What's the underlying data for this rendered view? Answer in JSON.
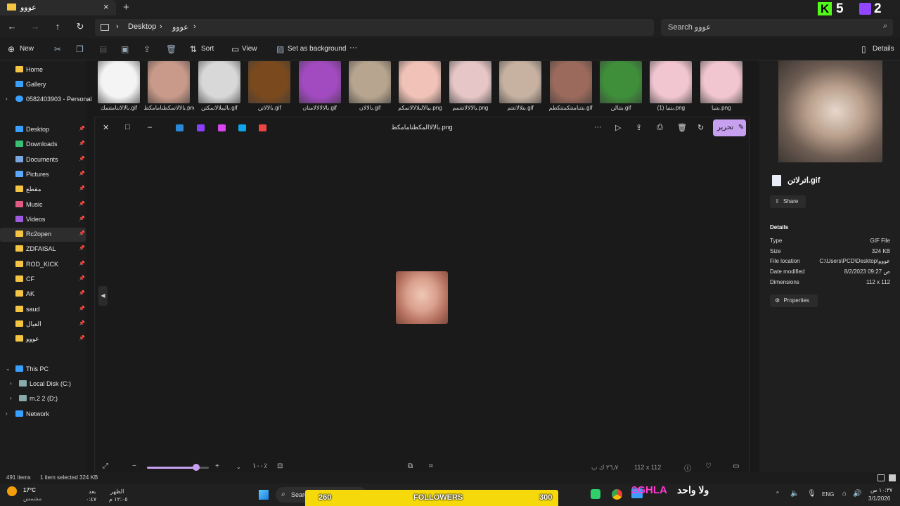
{
  "window": {
    "tab_title": "عووو",
    "tab_close": "×",
    "new_tab": "+",
    "kick_letter": "K",
    "kick_count": "5",
    "twitch_count": "2"
  },
  "address": {
    "back": "←",
    "forward": "→",
    "up": "↑",
    "refresh": "↻",
    "crumbs": [
      "Desktop",
      "عووو"
    ],
    "crumb_sep": "›",
    "search_placeholder": "Search عووو",
    "search_icon": "⌕"
  },
  "toolbar": {
    "new_label": "New",
    "sort_label": "Sort",
    "view_label": "View",
    "set_bg_label": "Set as background",
    "more_label": "···",
    "details_label": "Details"
  },
  "sidebar": {
    "top": [
      {
        "label": "Home",
        "color": "#f4c542"
      },
      {
        "label": "Gallery",
        "color": "#3aa0ff"
      },
      {
        "label": "0582403903 - Personal",
        "color": "#3aa0ff"
      }
    ],
    "pinned": [
      {
        "label": "Desktop",
        "color": "#3aa0ff"
      },
      {
        "label": "Downloads",
        "color": "#38c172"
      },
      {
        "label": "Documents",
        "color": "#7aa7e0"
      },
      {
        "label": "Pictures",
        "color": "#5aa8ff"
      },
      {
        "label": "مقطع",
        "color": "#f4c542"
      },
      {
        "label": "Music",
        "color": "#e05a84"
      },
      {
        "label": "Videos",
        "color": "#a05ae0"
      },
      {
        "label": "Rc2open",
        "color": "#f4c542"
      },
      {
        "label": "ZDFAISAL",
        "color": "#f4c542"
      },
      {
        "label": "ROD_KICK",
        "color": "#f4c542"
      },
      {
        "label": "CF",
        "color": "#f4c542"
      },
      {
        "label": "AK",
        "color": "#f4c542"
      },
      {
        "label": "saud",
        "color": "#f4c542"
      },
      {
        "label": "العيال",
        "color": "#f4c542"
      },
      {
        "label": "عووو",
        "color": "#f4c542"
      }
    ],
    "selected": "Rc2open",
    "this_pc": "This PC",
    "drives": [
      "Local Disk (C:)",
      "m.2 2 (D:)"
    ],
    "network": "Network"
  },
  "thumbnails": [
    {
      "label": "بالالاتنامتتمك.gif",
      "color": "#f4f4f4"
    },
    {
      "label": "بالالاتمكطنامامكط.png",
      "color": "#c99a8a"
    },
    {
      "label": "باليبلالاتمكتن.gif",
      "color": "#d8d8d8"
    },
    {
      "label": "بالالاتن.gif",
      "color": "#7a4a1e"
    },
    {
      "label": "بالالالالامتان.gif",
      "color": "#a24ac0"
    },
    {
      "label": "بالالان.gif",
      "color": "#b7a58f"
    },
    {
      "label": "بيالالبلالالاتمكم.png",
      "color": "#f1c3b8"
    },
    {
      "label": "بالالالاتتتمم.png",
      "color": "#e6c6c6"
    },
    {
      "label": "بتلالاتتتم.gif",
      "color": "#c7b2a2"
    },
    {
      "label": "بتتنامتتكمتتكطم.gif",
      "color": "#9b6a5c"
    },
    {
      "label": "بتتالن.gif",
      "color": "#3f8f3a"
    },
    {
      "label": "بتنيا (1).png",
      "color": "#f1c6d0"
    },
    {
      "label": "بتنيا.png",
      "color": "#f1c6d0"
    }
  ],
  "viewer": {
    "close": "✕",
    "restore": "□",
    "minimize": "–",
    "title": "بالالاالمكطنامامكط.png",
    "more": "···",
    "edit_label": "تحرير",
    "app_icon_colors": [
      "#2b88d8",
      "#8a3ffc",
      "#d946ef",
      "#0ea5e9",
      "#ef4444"
    ],
    "left_arrow": "◀",
    "zoom_out": "−",
    "zoom_in": "+",
    "zoom_level": "١٠٠٪",
    "zoom_percent": 0.8,
    "size_text": "٢٦٫٧ ك ب",
    "dims_text": "112 x 112",
    "info": "ⓘ",
    "fav": "♡"
  },
  "details": {
    "file_name": "اترلاتن.gif",
    "share_label": "Share",
    "section": "Details",
    "rows": [
      {
        "k": "Type",
        "v": "GIF File"
      },
      {
        "k": "Size",
        "v": "324 KB"
      },
      {
        "k": "File location",
        "v": "C:\\Users\\PCD\\Desktop\\عووو"
      },
      {
        "k": "Date modified",
        "v": "8/2/2023 09:27 ص"
      },
      {
        "k": "Dimensions",
        "v": "112 x 112"
      }
    ],
    "properties_label": "Properties"
  },
  "status": {
    "items": "491 items",
    "selected": "1 item selected",
    "size": "324 KB"
  },
  "taskbar": {
    "temp": "17°C",
    "weather": "مشمس",
    "clock_a_top": "بعد",
    "clock_a_bottom": "٠:٤٧",
    "clock_b_top": "الظهر",
    "clock_b_bottom": "١٢:٠٥ م",
    "search_label": "Search",
    "overlay_left": "260",
    "overlay_center": "FOLLOWERS",
    "overlay_right": "300",
    "brand": "2GHLA",
    "tagline": "ولا واحد",
    "lang": "ENG",
    "time": "١٠:٣٧ ص",
    "date": "3/1/2026"
  }
}
